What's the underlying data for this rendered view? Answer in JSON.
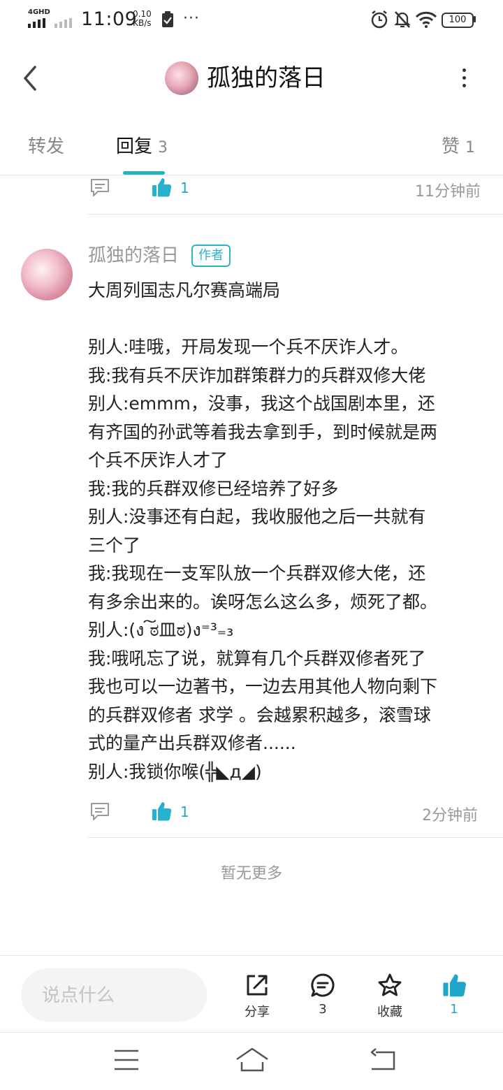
{
  "status_bar": {
    "network": "4GHD",
    "time": "11:09",
    "speed_value": "0.10",
    "speed_unit": "KB/s",
    "more": "···",
    "battery": "100"
  },
  "header": {
    "title": "孤独的落日"
  },
  "tabs": [
    {
      "label": "转发",
      "count": ""
    },
    {
      "label": "回复",
      "count": "3"
    },
    {
      "label": "赞",
      "count": "1"
    }
  ],
  "previous_reply": {
    "likes": "1",
    "time": "11分钟前"
  },
  "reply": {
    "author": "孤独的落日",
    "badge": "作者",
    "lines": [
      "大周列国志凡尔赛高端局",
      "",
      "别人:哇哦，开局发现一个兵不厌诈人才。",
      "我:我有兵不厌诈加群策群力的兵群双修大佬",
      "别人:emmm，没事，我这个战国剧本里，还",
      "有齐国的孙武等着我去拿到手，到时候就是两",
      "个兵不厌诈人才了",
      "我:我的兵群双修已经培养了好多",
      "别人:没事还有白起，我收服他之后一共就有",
      "三个了",
      "我:我现在一支军队放一个兵群双修大佬，还",
      "有多余出来的。诶呀怎么这么多，烦死了都。",
      "别人:(ง ͠ಠ皿ಠ)ง⁼³₌₃",
      "我:哦吼忘了说，就算有几个兵群双修者死了",
      "我也可以一边著书，一边去用其他人物向剩下",
      "的兵群双修者 求学 。会越累积越多，滚雪球",
      "式的量产出兵群双修者......",
      "别人:我锁你喉(╬◣д◢)"
    ],
    "likes": "1",
    "time": "2分钟前"
  },
  "no_more": "暂无更多",
  "action_bar": {
    "input_placeholder": "说点什么",
    "share_label": "分享",
    "comment_count": "3",
    "favorite_label": "收藏",
    "like_count": "1",
    "accent": "#1fa7c9"
  }
}
